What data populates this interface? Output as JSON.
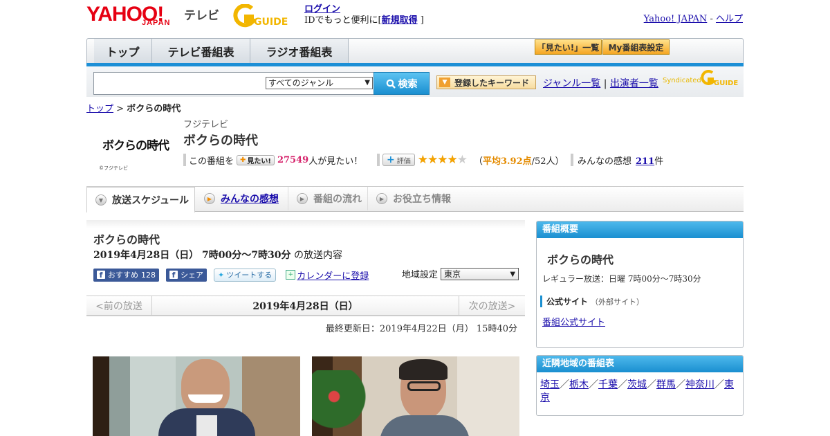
{
  "header": {
    "logo_yahoo": "YAHOO!",
    "logo_japan": "JAPAN",
    "logo_tv": "テレビ",
    "logo_gguide": "GUIDE",
    "login": "ログイン",
    "login_text_prefix": "IDでもっと便利に[",
    "signup": "新規取得",
    "login_text_suffix": "]",
    "yahoo_japan_link": "Yahoo! JAPAN",
    "separator": "-",
    "help_link": "ヘルプ"
  },
  "nav": {
    "tabs": [
      {
        "label": "トップ"
      },
      {
        "label": "テレビ番組表"
      },
      {
        "label": "ラジオ番組表"
      }
    ],
    "mitai_list": "「見たい!」一覧",
    "my_schedule": "My番組表設定"
  },
  "search": {
    "placeholder": "",
    "genre_selected": "すべてのジャンル",
    "search_button": "検索",
    "keyword_button": "登録したキーワード",
    "genre_list_link": "ジャンル一覧",
    "separator": "|",
    "cast_list_link": "出演者一覧",
    "syndicated": "Syndicated"
  },
  "breadcrumb": {
    "top": "トップ",
    "sep": ">",
    "current": "ボクらの時代"
  },
  "program": {
    "logo_text": "ボクらの時代",
    "copyright": "©フジテレビ",
    "station": "フジテレビ",
    "title": "ボクらの時代",
    "mitai_prefix": "この番組を",
    "mitai_button": "見たい!",
    "mitai_count": "27549",
    "mitai_suffix": "人が見たい！",
    "hyoka_button": "評価",
    "rating": 3.92,
    "rating_open": "（",
    "rating_avg": "平均3.92点",
    "rating_count": "/52人）",
    "kansou_prefix": "みんなの感想",
    "kansou_count": "211",
    "kansou_suffix": "件"
  },
  "subtabs": [
    {
      "label": "放送スケジュール"
    },
    {
      "label": "みんなの感想"
    },
    {
      "label": "番組の流れ"
    },
    {
      "label": "お役立ち情報"
    }
  ],
  "broadcast": {
    "title": "ボクらの時代",
    "datetime": "2019年4月28日（日） 7時00分～7時30分",
    "datetime_suffix": "の放送内容",
    "fb_recommend": "おすすめ",
    "fb_count": "128",
    "fb_share": "シェア",
    "tweet": "ツイートする",
    "calendar": "カレンダーに登録",
    "region_label": "地域設定",
    "region_selected": "東京",
    "prev": "<前の放送",
    "current_date": "2019年4月28日（日）",
    "next": "次の放送>",
    "updated": "最終更新日：2019年4月22日（月） 15時40分"
  },
  "sidebar": {
    "overview_header": "番組概要",
    "title": "ボクらの時代",
    "regular": "レギュラー放送：日曜 7時00分～7時30分",
    "official_label": "公式サイト",
    "official_sub": "（外部サイト）",
    "official_link": "番組公式サイト",
    "nearby_header": "近隣地域の番組表",
    "regions": [
      "埼玉",
      "栃木",
      "千葉",
      "茨城",
      "群馬",
      "神奈川",
      "東京"
    ],
    "region_sep": "／"
  },
  "colors": {
    "brand_red": "#e60012",
    "accent_blue": "#1a8fd0",
    "star": "#f5a300",
    "pink": "#d6246c"
  }
}
